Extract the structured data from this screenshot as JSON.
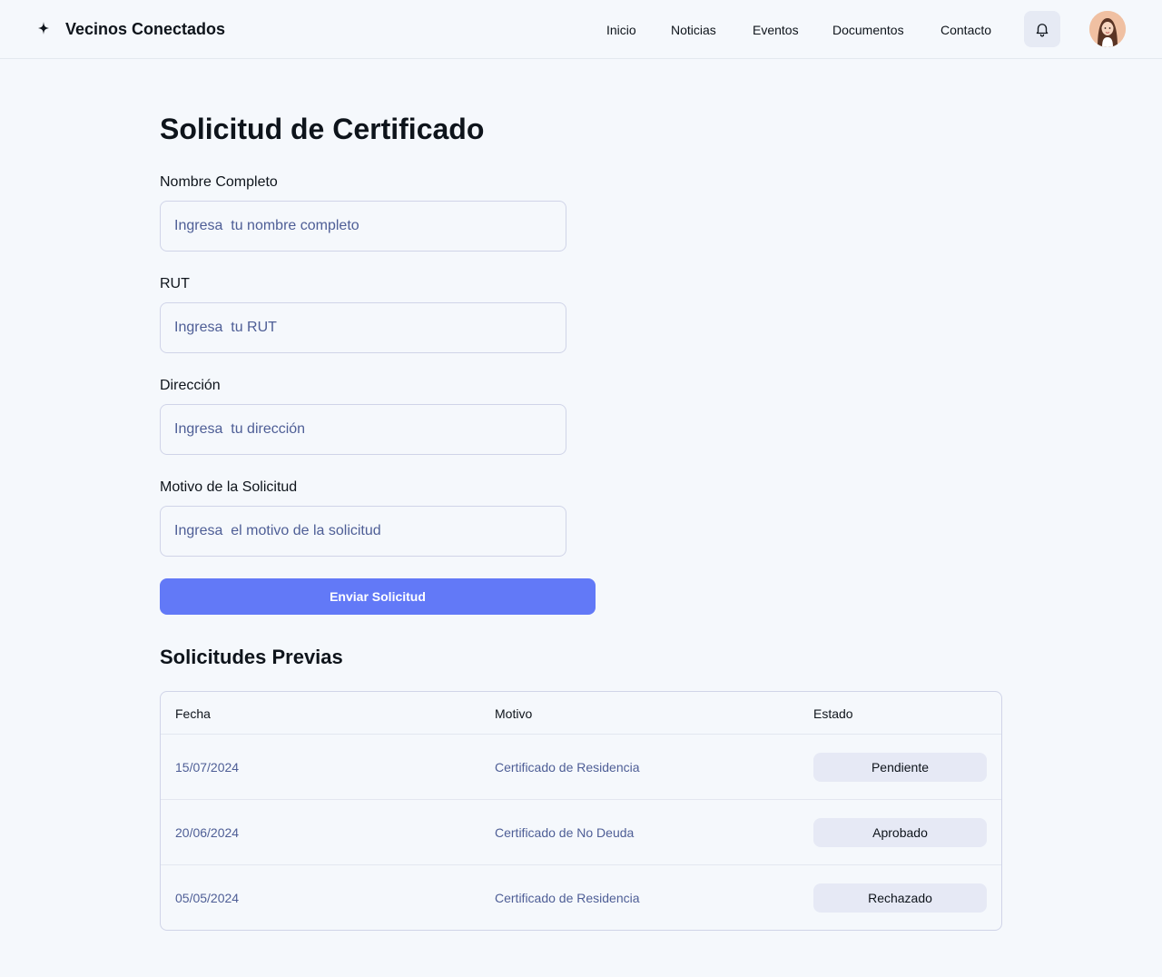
{
  "header": {
    "brand": "Vecinos Conectados",
    "nav": [
      "Inicio",
      "Noticias",
      "Eventos",
      "Documentos",
      "Contacto"
    ]
  },
  "form": {
    "title": "Solicitud de Certificado",
    "fields": [
      {
        "label": "Nombre Completo",
        "placeholder": "Ingresa  tu nombre completo",
        "value": ""
      },
      {
        "label": "RUT",
        "placeholder": "Ingresa  tu RUT",
        "value": ""
      },
      {
        "label": "Dirección",
        "placeholder": "Ingresa  tu dirección",
        "value": ""
      },
      {
        "label": "Motivo de la Solicitud",
        "placeholder": "Ingresa  el motivo de la solicitud",
        "value": ""
      }
    ],
    "submit_label": "Enviar Solicitud"
  },
  "previous": {
    "title": "Solicitudes Previas",
    "columns": [
      "Fecha",
      "Motivo",
      "Estado"
    ],
    "rows": [
      {
        "fecha": "15/07/2024",
        "motivo": "Certificado de Residencia",
        "estado": "Pendiente"
      },
      {
        "fecha": "20/06/2024",
        "motivo": "Certificado de No Deuda",
        "estado": "Aprobado"
      },
      {
        "fecha": "05/05/2024",
        "motivo": "Certificado de Residencia",
        "estado": "Rechazado"
      }
    ]
  },
  "icons": {
    "logo": "sparkle-icon",
    "notifications": "bell-icon",
    "avatar": "user-avatar"
  },
  "colors": {
    "accent": "#6279f7",
    "background": "#f5f8fc",
    "muted_text": "#4e5e96",
    "badge_bg": "#e6e9f5"
  }
}
